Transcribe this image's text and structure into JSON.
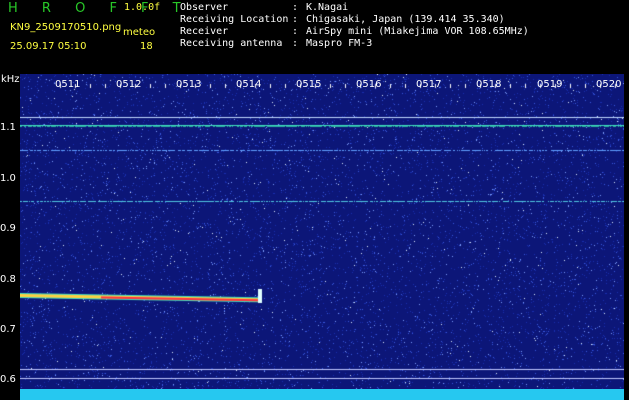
{
  "header": {
    "app_title": "H R O F F T",
    "version": "1.0.0f",
    "filename": "KN9_2509170510.png",
    "datetime": "25.09.17 05:10",
    "meteor_label": "meteo",
    "meteor_count": "18"
  },
  "info": [
    {
      "key": "Observer",
      "sep": ":",
      "value": "K.Nagai"
    },
    {
      "key": "Receiving Location",
      "sep": ":",
      "value": "Chigasaki, Japan (139.414 35.340)"
    },
    {
      "key": "Receiver",
      "sep": ":",
      "value": "AirSpy mini (Miakejima VOR 108.65MHz)"
    },
    {
      "key": "Receiving antenna",
      "sep": ":",
      "value": "Maspro FM-3"
    }
  ],
  "axes": {
    "y_unit": "kHz",
    "y_ticks": [
      "1.1",
      "1.0",
      "0.9",
      "0.8",
      "0.7",
      "0.6"
    ],
    "x_ticks": [
      "0511",
      "0512",
      "0513",
      "0514",
      "0515",
      "0516",
      "0517",
      "0518",
      "0519",
      "0520"
    ]
  },
  "colors": {
    "background": "#0c1678",
    "signal_cyan": "#40e0c0",
    "echo_red": "#ff3040",
    "header_yellow": "#ffff40",
    "title_green": "#28c828"
  }
}
